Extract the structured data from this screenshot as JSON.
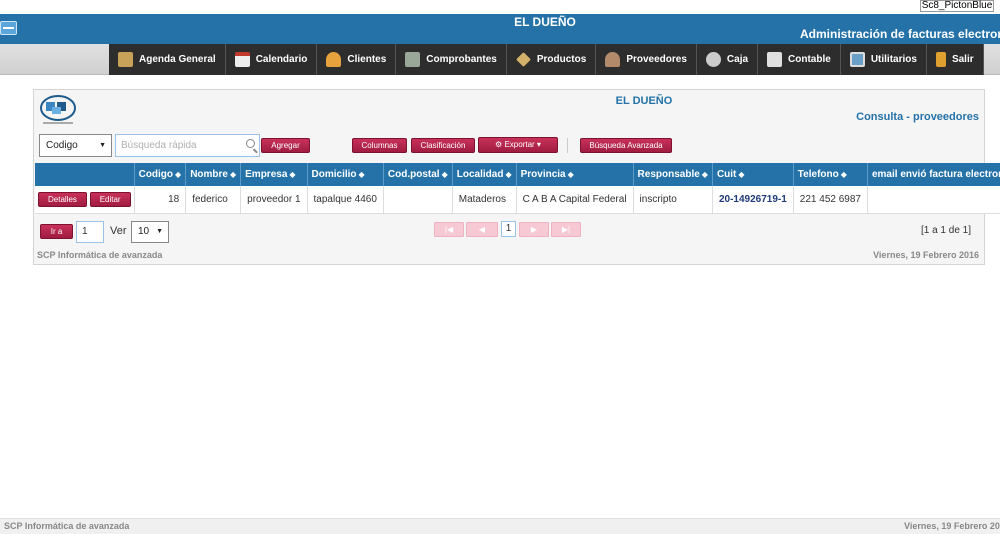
{
  "theme": "Sc8_PictonBlue",
  "header": {
    "brand": "EL DUEÑO",
    "subtitle": "Administración de facturas electronicas"
  },
  "menu": [
    {
      "label": "Agenda General",
      "icon": "agenda-icon",
      "color": "#c9a25a"
    },
    {
      "label": "Calendario",
      "icon": "calendar-icon",
      "color": "#c0392b"
    },
    {
      "label": "Clientes",
      "icon": "users-icon",
      "color": "#e6a23c"
    },
    {
      "label": "Comprobantes",
      "icon": "printer-icon",
      "color": "#8fbf7f"
    },
    {
      "label": "Productos",
      "icon": "pencil-icon",
      "color": "#d4b16a"
    },
    {
      "label": "Proveedores",
      "icon": "person-icon",
      "color": "#b38a6a"
    },
    {
      "label": "Caja",
      "icon": "coin-icon",
      "color": "#cccccc"
    },
    {
      "label": "Contable",
      "icon": "register-icon",
      "color": "#e0e0e0"
    },
    {
      "label": "Utilitarios",
      "icon": "tools-icon",
      "color": "#6aa0c8"
    },
    {
      "label": "Salir",
      "icon": "door-icon",
      "color": "#e0a030"
    }
  ],
  "panel": {
    "title": "EL DUEÑO",
    "subtitle": "Consulta - proveedores"
  },
  "toolbar": {
    "field_select": "Codigo",
    "search_placeholder": "Búsqueda rápida",
    "add_label": "Agregar",
    "columns_label": "Columnas",
    "sort_label": "Clasificación",
    "export_label": "Exportar",
    "advanced_search_label": "Búsqueda Avanzada"
  },
  "table": {
    "columns": [
      "Codigo",
      "Nombre",
      "Empresa",
      "Domicilio",
      "Cod.postal",
      "Localidad",
      "Provincia",
      "Responsable",
      "Cuit",
      "Telefono",
      "email envió factura electronica"
    ],
    "rows": [
      {
        "details_label": "Detalles",
        "edit_label": "Editar",
        "codigo": "18",
        "nombre": "federico",
        "empresa": "proveedor 1",
        "domicilio": "tapalque 4460",
        "cod_postal": "",
        "localidad": "Mataderos",
        "provincia": "C A B A Capital Federal",
        "responsable": "inscripto",
        "cuit": "20-14926719-1",
        "telefono": "221 452 6987",
        "email": ""
      }
    ]
  },
  "pager": {
    "goto_label": "Ir a",
    "goto_value": "1",
    "view_label": "Ver",
    "page_size": "10",
    "current_page": "1",
    "summary": "[1 a 1 de 1]"
  },
  "footer": {
    "company": "SCP Informática de avanzada",
    "date": "Viernes, 19 Febrero 2016"
  },
  "colors": {
    "primary": "#2472a8",
    "accent": "#b0224a"
  }
}
